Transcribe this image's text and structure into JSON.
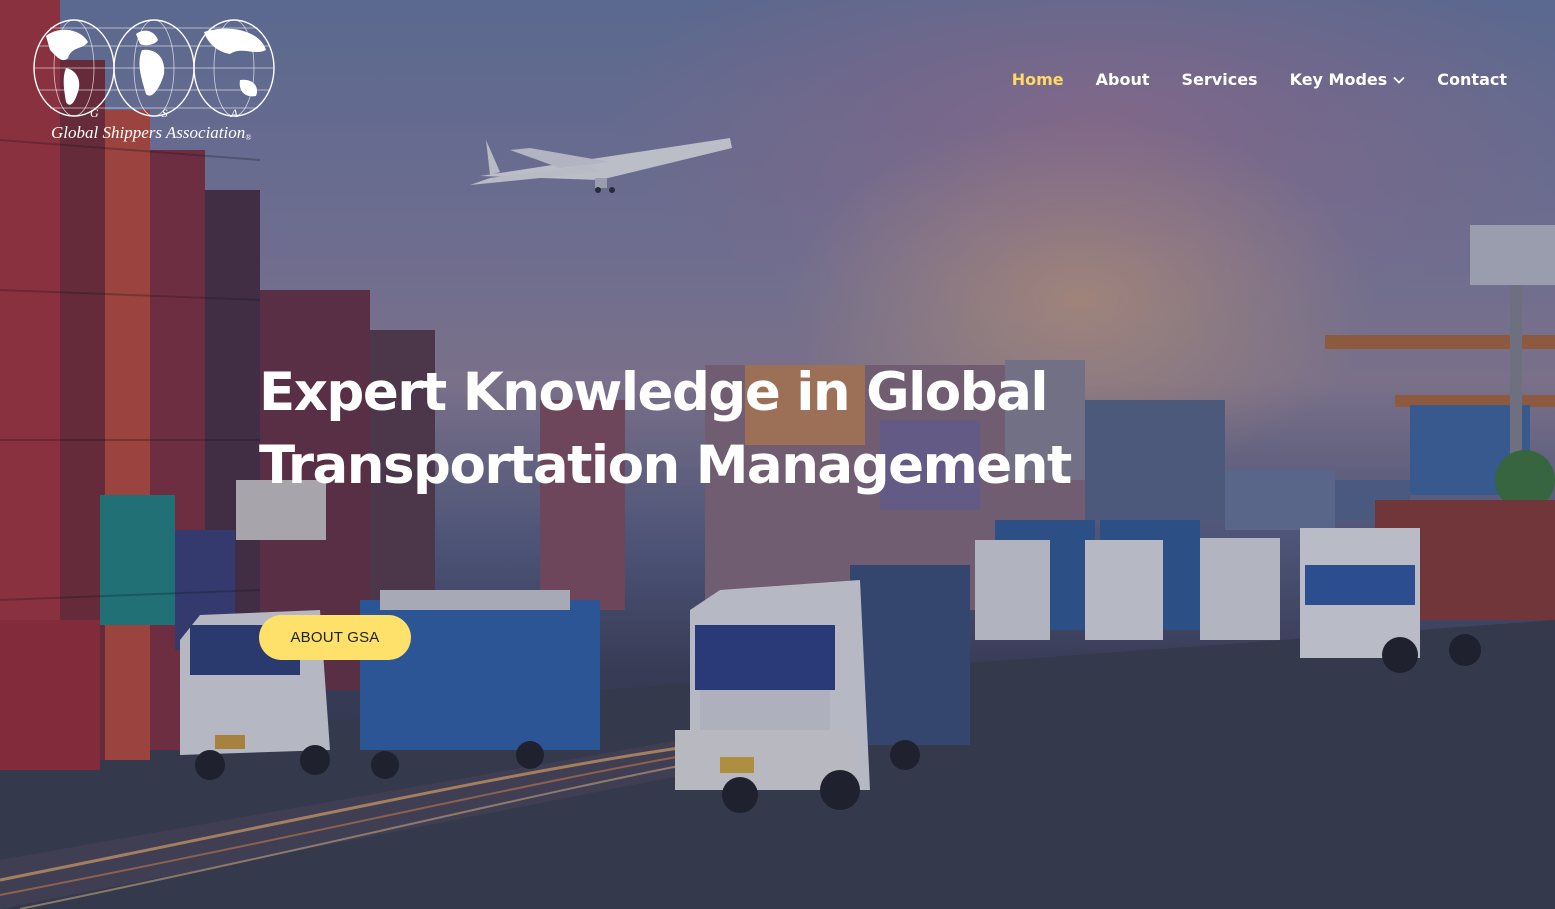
{
  "logo": {
    "letters": [
      "G",
      "S",
      "A"
    ],
    "name": "Global Shippers Association",
    "registered": "®"
  },
  "nav": {
    "items": [
      {
        "label": "Home",
        "active": true
      },
      {
        "label": "About",
        "active": false
      },
      {
        "label": "Services",
        "active": false
      },
      {
        "label": "Key Modes",
        "active": false,
        "icon": "chevron-down-icon"
      },
      {
        "label": "Contact",
        "active": false
      }
    ]
  },
  "hero": {
    "headline": "Expert Knowledge in Global Transportation Management",
    "cta_label": "ABOUT GSA"
  },
  "colors": {
    "accent": "#ffd966",
    "button": "#fde16b",
    "text": "#ffffff"
  }
}
